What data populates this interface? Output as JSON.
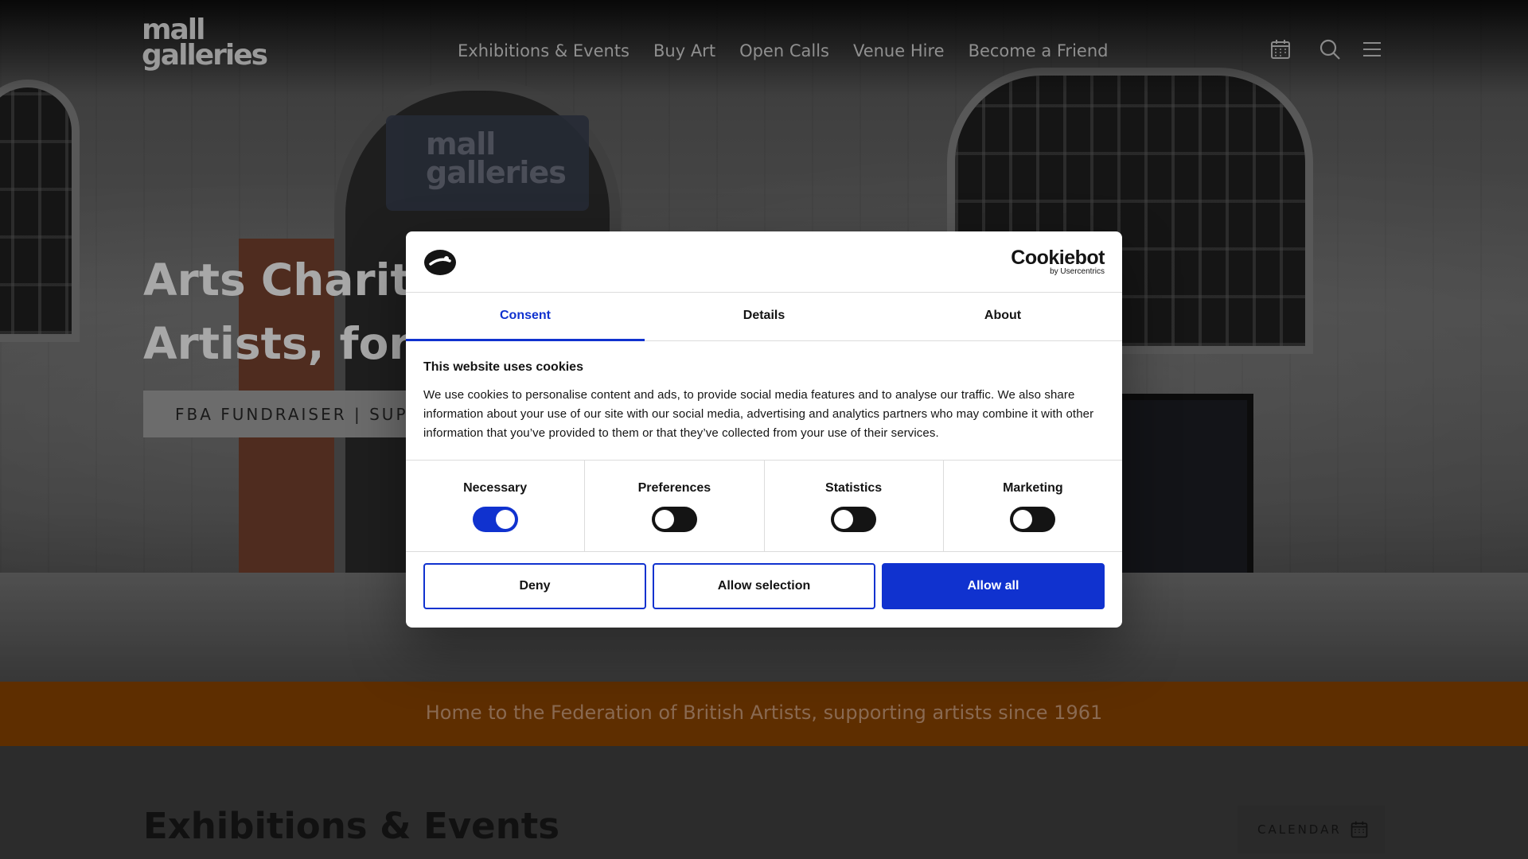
{
  "header": {
    "logo_line1": "mall",
    "logo_line2": "galleries",
    "nav": [
      "Exhibitions & Events",
      "Buy Art",
      "Open Calls",
      "Venue Hire",
      "Become a Friend"
    ]
  },
  "hero": {
    "title_line1": "Arts Charity",
    "title_line2": "Artists, for A",
    "button_label": "FBA FUNDRAISER | SUPPO",
    "sign_line1": "mall",
    "sign_line2": "galleries"
  },
  "strip": {
    "text": "Home to the Federation of British Artists, supporting artists since 1961"
  },
  "section": {
    "heading": "Exhibitions & Events",
    "calendar_label": "CALENDAR"
  },
  "cookie": {
    "brand": "Cookiebot",
    "brand_sub": "by Usercentrics",
    "tabs": [
      "Consent",
      "Details",
      "About"
    ],
    "heading": "This website uses cookies",
    "body": "We use cookies to personalise content and ads, to provide social media features and to analyse our traffic. We also share information about your use of our site with our social media, advertising and analytics partners who may combine it with other information that you’ve provided to them or that they’ve collected from your use of their services.",
    "toggles": [
      {
        "label": "Necessary",
        "on": true
      },
      {
        "label": "Preferences",
        "on": false
      },
      {
        "label": "Statistics",
        "on": false
      },
      {
        "label": "Marketing",
        "on": false
      }
    ],
    "buttons": {
      "deny": "Deny",
      "selection": "Allow selection",
      "all": "Allow all"
    }
  },
  "colors": {
    "accent": "#1032cf",
    "strip": "#5e2e00"
  }
}
